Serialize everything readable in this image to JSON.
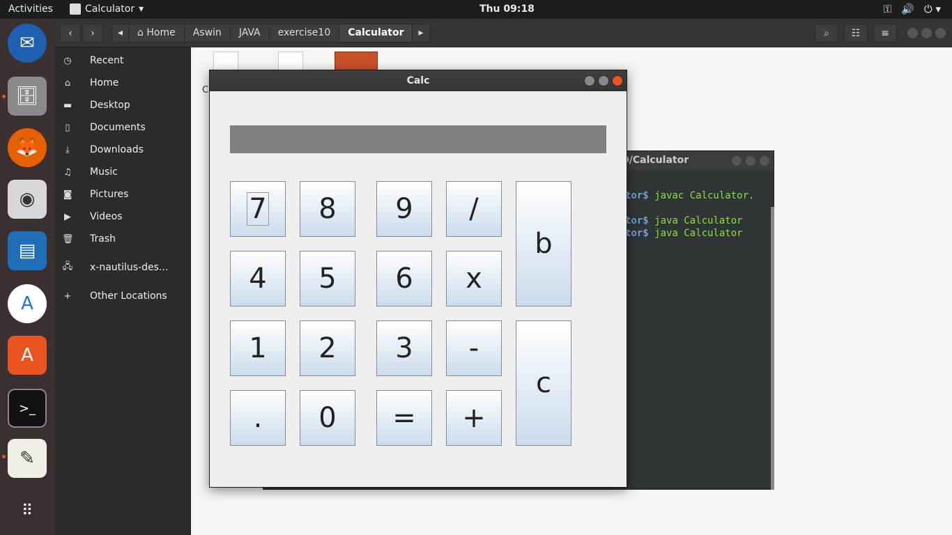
{
  "topbar": {
    "activities": "Activities",
    "app_name": "Calculator",
    "clock": "Thu 09:18"
  },
  "dock": {
    "items": [
      "thunderbird-icon",
      "files-icon",
      "firefox-icon",
      "rhythmbox-icon",
      "libreoffice-writer-icon",
      "android-studio-icon",
      "software-center-icon",
      "terminal-icon",
      "text-editor-icon",
      "show-apps-icon"
    ]
  },
  "files": {
    "breadcrumbs": [
      "Home",
      "Aswin",
      "JAVA",
      "exercise10",
      "Calculator"
    ],
    "sidebar": [
      {
        "label": "Recent",
        "icon": "clock-icon"
      },
      {
        "label": "Home",
        "icon": "home-icon"
      },
      {
        "label": "Desktop",
        "icon": "folder-icon"
      },
      {
        "label": "Documents",
        "icon": "document-icon"
      },
      {
        "label": "Downloads",
        "icon": "download-icon"
      },
      {
        "label": "Music",
        "icon": "music-icon"
      },
      {
        "label": "Pictures",
        "icon": "camera-icon"
      },
      {
        "label": "Videos",
        "icon": "video-icon"
      },
      {
        "label": "Trash",
        "icon": "trash-icon"
      },
      {
        "label": "x-nautilus-des...",
        "icon": "network-icon"
      },
      {
        "label": "Other Locations",
        "icon": "plus-icon"
      }
    ],
    "content_label_fragment": "C"
  },
  "terminal": {
    "title": "0/Calculator",
    "lines": [
      {
        "prompt": "tor$",
        "cmd": " javac Calculator."
      },
      {
        "prompt": "tor$",
        "cmd": " java Calculator"
      },
      {
        "prompt": "tor$",
        "cmd": " java Calculator"
      }
    ]
  },
  "calc": {
    "title": "Calc",
    "display": "",
    "keys": {
      "k7": "7",
      "k8": "8",
      "k9": "9",
      "kdiv": "/",
      "kb": "b",
      "k4": "4",
      "k5": "5",
      "k6": "6",
      "kmul": "x",
      "k1": "1",
      "k2": "2",
      "k3": "3",
      "ksub": "-",
      "kc": "c",
      "kdot": ".",
      "k0": "0",
      "keq": "=",
      "kadd": "+"
    }
  }
}
